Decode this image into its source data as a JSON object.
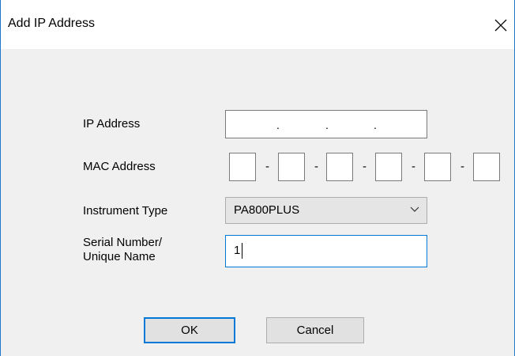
{
  "dialog": {
    "title": "Add IP Address"
  },
  "form": {
    "ip_label": "IP Address",
    "ip_value": "",
    "ip_dot": ".",
    "mac_label": "MAC Address",
    "mac_separator": "-",
    "mac_octets": [
      "",
      "",
      "",
      "",
      "",
      ""
    ],
    "instrument_label": "Instrument Type",
    "instrument_value": "PA800PLUS",
    "serial_label_line1": "Serial Number/",
    "serial_label_line2": "Unique Name",
    "serial_value": "1"
  },
  "buttons": {
    "ok_label": "OK",
    "cancel_label": "Cancel"
  },
  "colors": {
    "accent": "#0078d7",
    "window_border": "#1f78c8",
    "dialog_bg": "#f0f0f0"
  }
}
